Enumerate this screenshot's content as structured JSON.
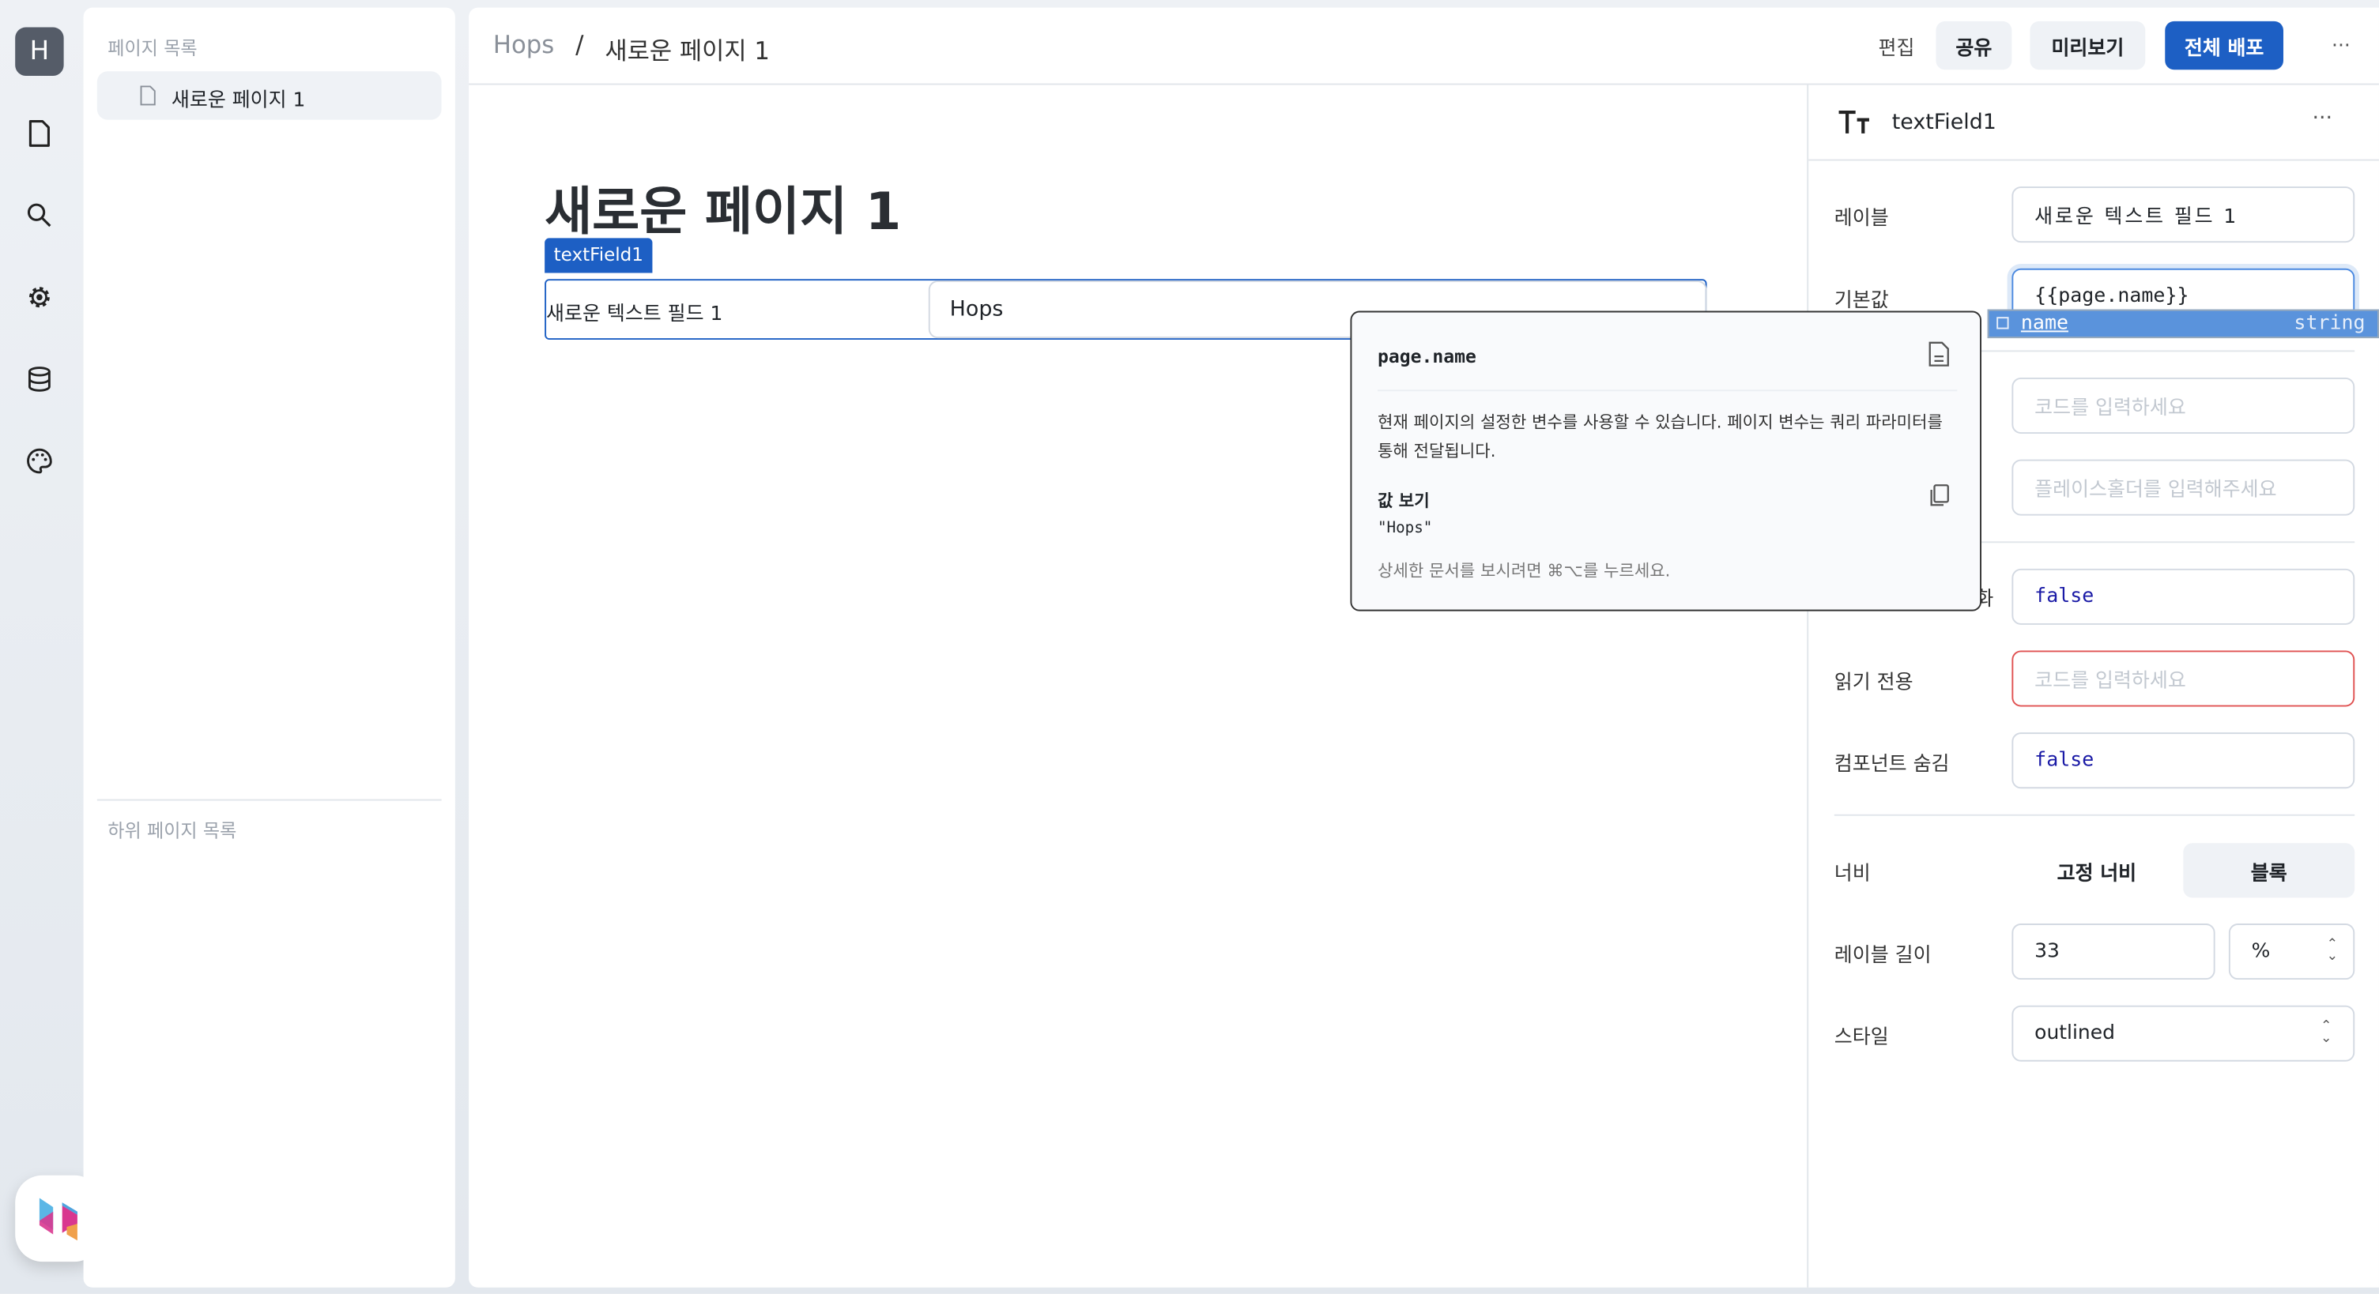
{
  "rail": {
    "avatar": "H",
    "items": [
      {
        "icon": "file-icon"
      },
      {
        "icon": "search-icon"
      },
      {
        "icon": "gear-icon"
      },
      {
        "icon": "database-icon"
      },
      {
        "icon": "palette-icon"
      }
    ]
  },
  "pages": {
    "heading": "페이지 목록",
    "items": [
      {
        "label": "새로운 페이지 1",
        "selected": true
      }
    ],
    "sub_heading": "하위 페이지 목록"
  },
  "header": {
    "breadcrumb": [
      "Hops",
      "/",
      "새로운 페이지 1"
    ],
    "edit": "편집",
    "share": "공유",
    "preview": "미리보기",
    "deploy": "전체 배포",
    "more": "···",
    "accent": "#1d5fc4"
  },
  "canvas": {
    "title": "새로운 페이지 1",
    "badge": "textField1",
    "field_label": "새로운 텍스트 필드 1",
    "field_value": "Hops"
  },
  "popup": {
    "title": "page.name",
    "description": "현재 페이지의 설정한 변수를 사용할 수 있습니다. 페이지 변수는 쿼리 파라미터를 통해 전달됩니다.",
    "value_heading": "값 보기",
    "value": "\"Hops\"",
    "hint": "상세한 문서를 보시려면 ⌘⌥를 누르세요."
  },
  "autocomplete": {
    "name": "name",
    "type": "string",
    "color": "#5a93dc"
  },
  "inspector": {
    "component": "textField1",
    "more": "···",
    "label_label": "레이블",
    "label_value": "새로운 텍스트 필드 1",
    "default_label": "기본값",
    "default_value": "{{page.name}}",
    "code_placeholder": "코드를 입력하세요",
    "placeholder_placeholder": "플레이스홀더를 입력해주세요",
    "disabled_label_fragment": "화",
    "disabled_value": "false",
    "readonly_label": "읽기 전용",
    "readonly_placeholder": "코드를 입력하세요",
    "hidden_label": "컴포넌트 숨김",
    "hidden_value": "false",
    "width_label": "너비",
    "width_fixed": "고정 너비",
    "width_block": "블록",
    "label_length_label": "레이블 길이",
    "label_length_value": "33",
    "label_length_unit": "%",
    "style_label": "스타일",
    "style_value": "outlined"
  }
}
